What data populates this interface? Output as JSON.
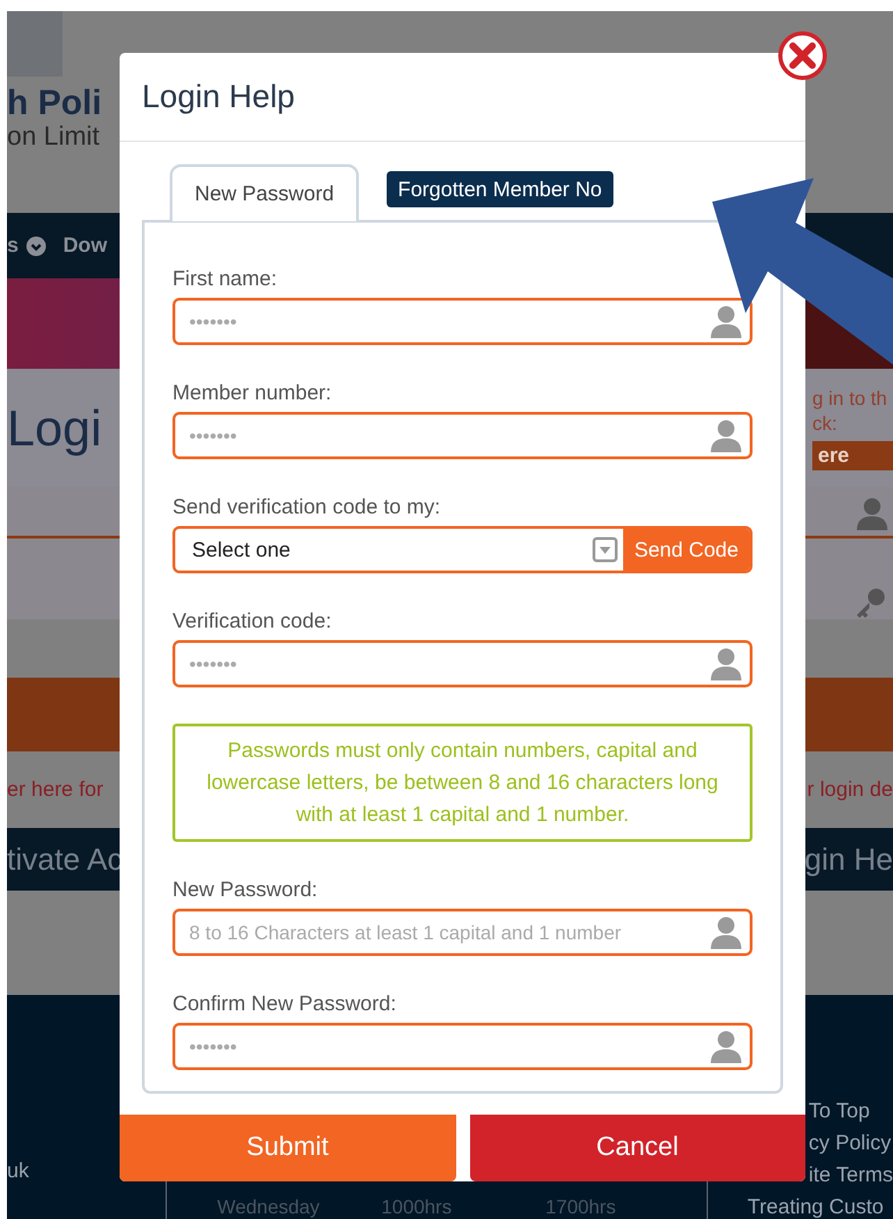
{
  "background_page": {
    "header": {
      "logo_line_1": "h Poli",
      "logo_line_2": "on Limit"
    },
    "nav": [
      {
        "label": "s",
        "dropdown": true
      },
      {
        "label": "Dow",
        "dropdown": false
      }
    ],
    "login_panel": {
      "title": "Logi",
      "intro_lines": [
        "g in to th",
        "ck:"
      ],
      "here_button": "ere"
    },
    "links": [
      "er here for",
      "r login de"
    ],
    "band": [
      "tivate Ac",
      "gin He"
    ],
    "footer": {
      "left_text": "uk",
      "hours": [
        {
          "day": "Wednesday",
          "open": "1000hrs",
          "close": "1700hrs"
        }
      ],
      "links": [
        "To Top",
        "cy Policy",
        "ite Terms",
        "Treating Custo"
      ]
    }
  },
  "modal": {
    "title": "Login Help",
    "tabs": [
      {
        "label": "New Password",
        "selected": true
      },
      {
        "label": "Forgotten Member No",
        "selected": false
      }
    ],
    "fields": [
      {
        "kind": "text",
        "label": "First name:",
        "placeholder": "•••••••"
      },
      {
        "kind": "text",
        "label": "Member number:",
        "placeholder": "•••••••"
      },
      {
        "kind": "select",
        "label": "Send verification code to my:",
        "value": "Select one",
        "button": "Send Code"
      },
      {
        "kind": "text",
        "label": "Verification code:",
        "placeholder": "•••••••"
      },
      {
        "kind": "note",
        "text": "Passwords must only contain numbers, capital and lowercase letters, be between 8 and 16 characters long with at least 1 capital and 1 number."
      },
      {
        "kind": "text",
        "label": "New Password:",
        "placeholder": "8 to 16 Characters at least 1 capital and 1 number"
      },
      {
        "kind": "text",
        "label": "Confirm New Password:",
        "placeholder": "•••••••"
      }
    ],
    "buttons": [
      {
        "kind": "submit",
        "label": "Submit"
      },
      {
        "kind": "cancel",
        "label": "Cancel"
      }
    ]
  }
}
